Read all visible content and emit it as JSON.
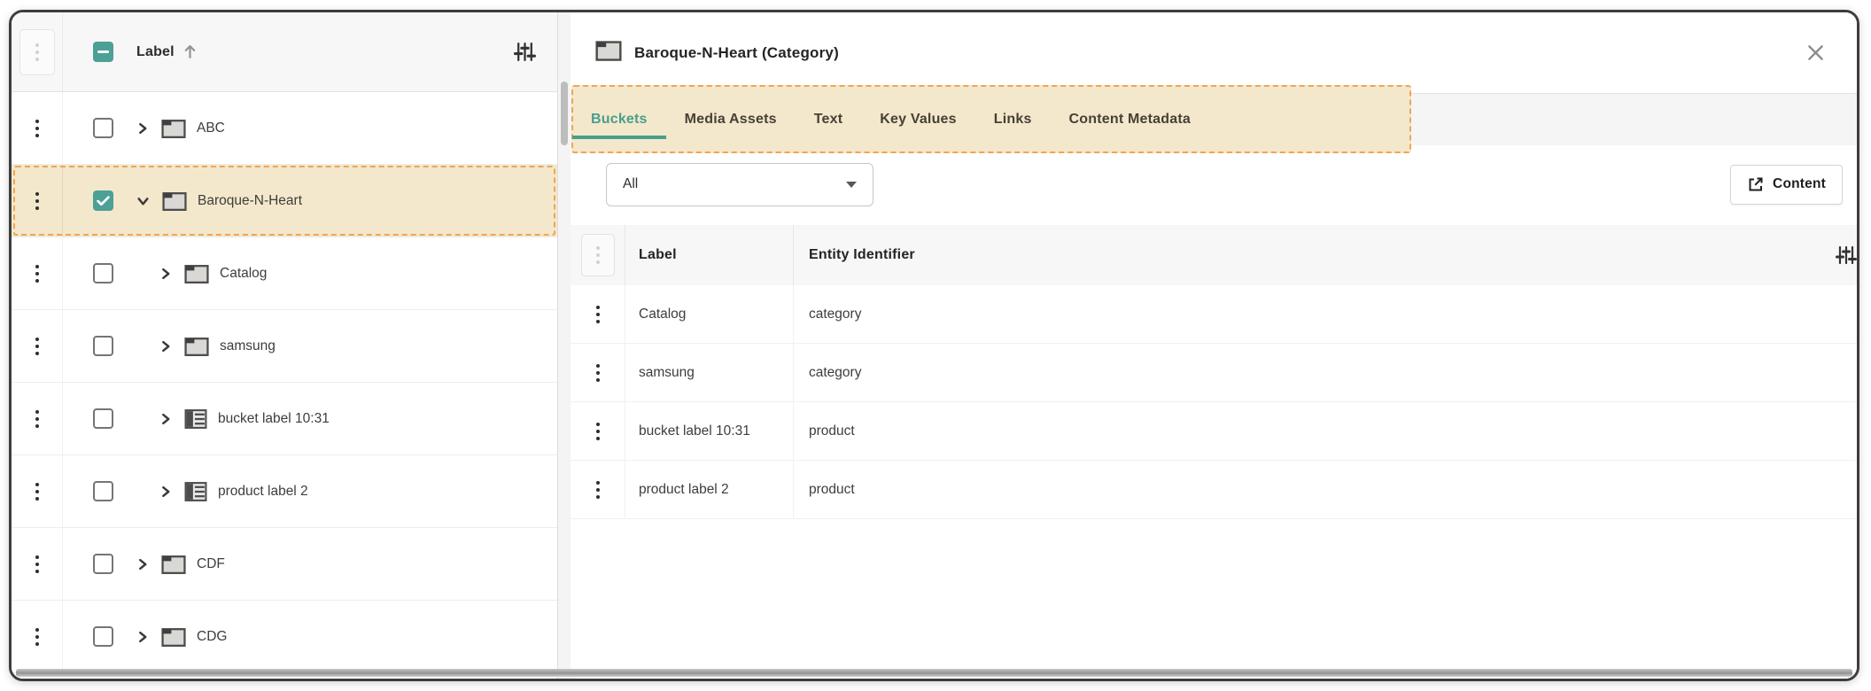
{
  "colors": {
    "accent_teal": "#4A9E8C",
    "checkbox_teal": "#4CA096",
    "annotation_bg": "#F3E8CC",
    "annotation_border": "#F1A453",
    "header_gray": "#F7F7F7"
  },
  "left_panel": {
    "header": {
      "select_all_state": "indeterminate",
      "label": "Label",
      "sort_direction": "ascending",
      "filter_icon": "tune-icon"
    },
    "rows": [
      {
        "label": "ABC",
        "icon": "folder",
        "level": 0,
        "expanded": false,
        "checked": false,
        "selected": false
      },
      {
        "label": "Baroque-N-Heart",
        "icon": "folder",
        "level": 0,
        "expanded": true,
        "checked": true,
        "selected": true
      },
      {
        "label": "Catalog",
        "icon": "folder",
        "level": 1,
        "expanded": false,
        "checked": false,
        "selected": false
      },
      {
        "label": "samsung",
        "icon": "folder",
        "level": 1,
        "expanded": false,
        "checked": false,
        "selected": false
      },
      {
        "label": "bucket label 10:31",
        "icon": "bucket",
        "level": 1,
        "expanded": false,
        "checked": false,
        "selected": false
      },
      {
        "label": "product label 2",
        "icon": "bucket",
        "level": 1,
        "expanded": false,
        "checked": false,
        "selected": false
      },
      {
        "label": "CDF",
        "icon": "folder",
        "level": 0,
        "expanded": false,
        "checked": false,
        "selected": false
      },
      {
        "label": "CDG",
        "icon": "folder",
        "level": 0,
        "expanded": false,
        "checked": false,
        "selected": false
      }
    ]
  },
  "right_panel": {
    "title": "Baroque-N-Heart (Category)",
    "title_icon": "folder",
    "close_icon": "close-x",
    "tabs": [
      {
        "label": "Buckets",
        "active": true
      },
      {
        "label": "Media Assets",
        "active": false
      },
      {
        "label": "Text",
        "active": false
      },
      {
        "label": "Key Values",
        "active": false
      },
      {
        "label": "Links",
        "active": false
      },
      {
        "label": "Content Metadata",
        "active": false
      }
    ],
    "bucket_filter": {
      "value": "All"
    },
    "content_button": {
      "label": "Content",
      "icon": "open-in-new"
    },
    "table": {
      "columns": [
        "Label",
        "Entity Identifier"
      ],
      "rows": [
        {
          "label": "Catalog",
          "entity_identifier": "category"
        },
        {
          "label": "samsung",
          "entity_identifier": "category"
        },
        {
          "label": "bucket label 10:31",
          "entity_identifier": "product"
        },
        {
          "label": "product label 2",
          "entity_identifier": "product"
        }
      ]
    }
  }
}
